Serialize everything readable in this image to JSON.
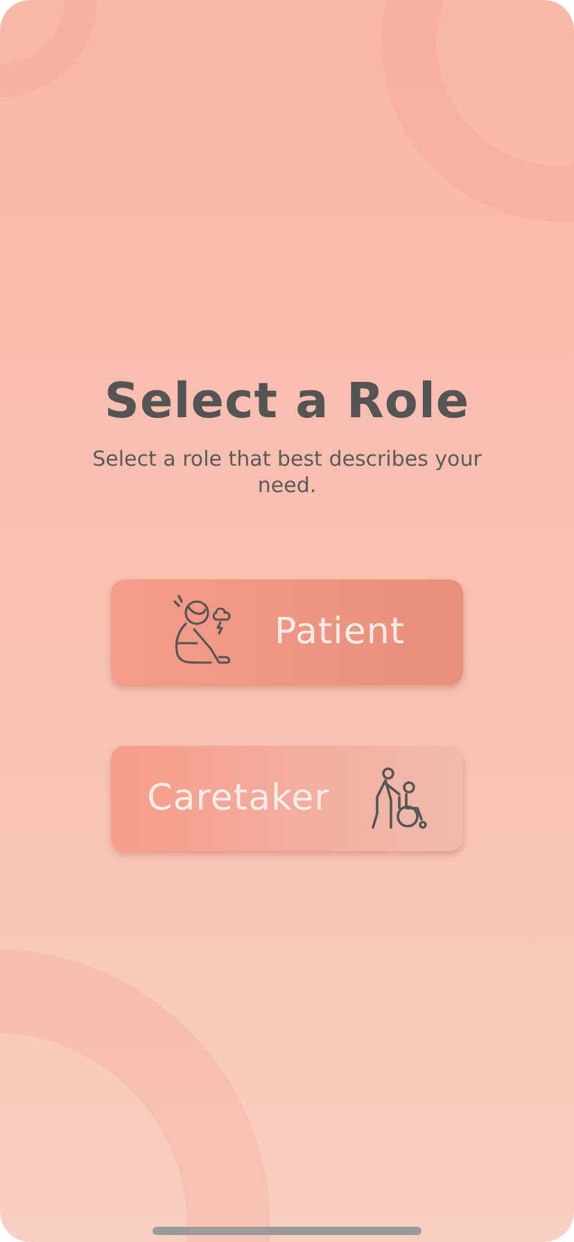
{
  "title": "Select a Role",
  "subtitle": "Select a role that best describes your need.",
  "roles": [
    {
      "label": "Patient",
      "kind": "icon-left"
    },
    {
      "label": "Caretaker",
      "kind": "icon-right"
    }
  ]
}
